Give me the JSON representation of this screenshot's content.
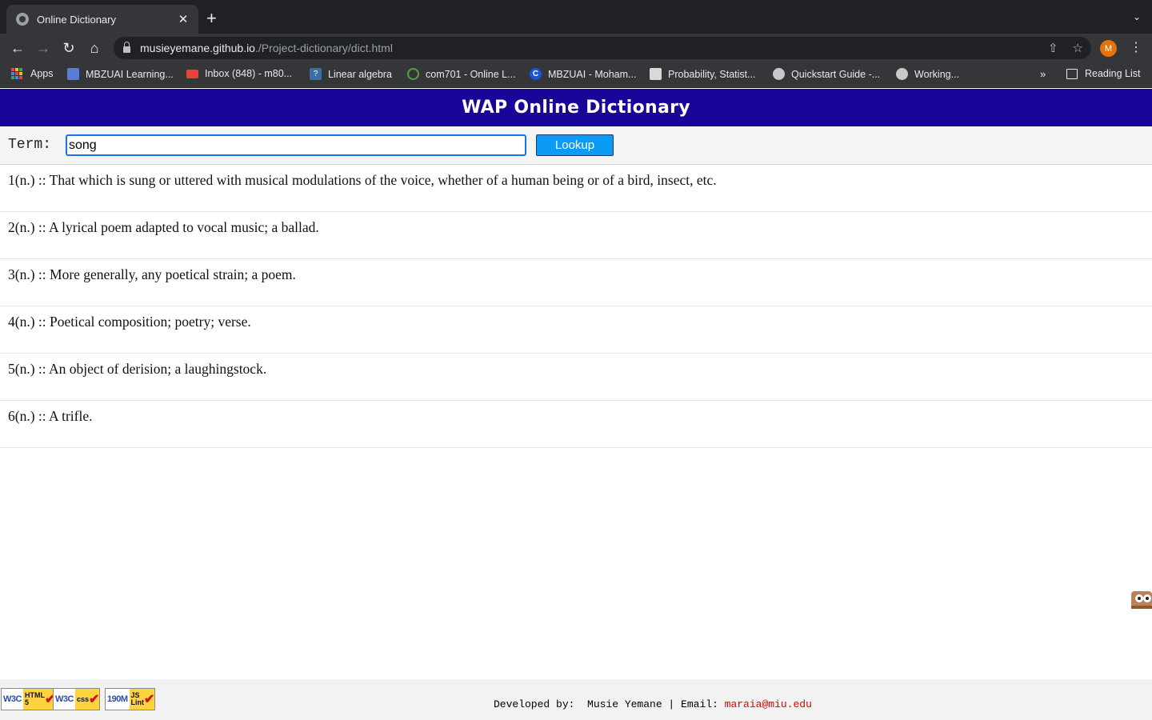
{
  "browser": {
    "tab_title": "Online Dictionary",
    "tab_close": "✕",
    "new_tab": "+",
    "url_host": "musieyemane.github.io",
    "url_path": "./Project-dictionary/dict.html",
    "avatar_initial": "M",
    "bookmarks": [
      {
        "label": "Apps",
        "icon": "apps-grid-icon"
      },
      {
        "label": "MBZUAI Learning...",
        "icon": "mbzuai-icon",
        "color": "#5a7bd6"
      },
      {
        "label": "Inbox (848) - m80...",
        "icon": "gmail-icon",
        "color": "#ea4335"
      },
      {
        "label": "Linear algebra",
        "icon": "question-icon",
        "color": "#3a6ea5"
      },
      {
        "label": "com701 - Online L...",
        "icon": "moodle-icon",
        "color": "#56a339"
      },
      {
        "label": "MBZUAI - Moham...",
        "icon": "c-icon",
        "color": "#1a56db"
      },
      {
        "label": "Probability, Statist...",
        "icon": "doc-icon",
        "color": "#d9d9d9"
      },
      {
        "label": "Quickstart Guide -...",
        "icon": "globe-icon",
        "color": "#c8c8c8"
      },
      {
        "label": "Working...",
        "icon": "globe-icon",
        "color": "#c8c8c8"
      }
    ],
    "bookmarks_more": "»",
    "reading_list": "Reading List"
  },
  "page": {
    "banner_title": "WAP Online Dictionary",
    "term_label": "Term:",
    "term_value": "song",
    "lookup_label": "Lookup",
    "definitions": [
      "1(n.) :: That which is sung or uttered with musical modulations of the voice, whether of a human being or of a bird, insect, etc.",
      "2(n.) :: A lyrical poem adapted to vocal music; a ballad.",
      "3(n.) :: More generally, any poetical strain; a poem.",
      "4(n.) :: Poetical composition; poetry; verse.",
      "5(n.) :: An object of derision; a laughingstock.",
      "6(n.) :: A trifle."
    ],
    "footer": {
      "badges": [
        {
          "org": "W3C",
          "text_top": "HTML",
          "text_bottom": "5"
        },
        {
          "org": "W3C",
          "text_top": "css",
          "text_bottom": ""
        },
        {
          "org": "190M",
          "text_top": "JS",
          "text_bottom": "Lint"
        }
      ],
      "developed_by": "Developed by:  Musie Yemane | Email: ",
      "email": "maraia@miu.edu"
    },
    "colors": {
      "banner": "#1a0599",
      "lookup_button": "#0a9cf5",
      "email": "#e00000"
    }
  }
}
